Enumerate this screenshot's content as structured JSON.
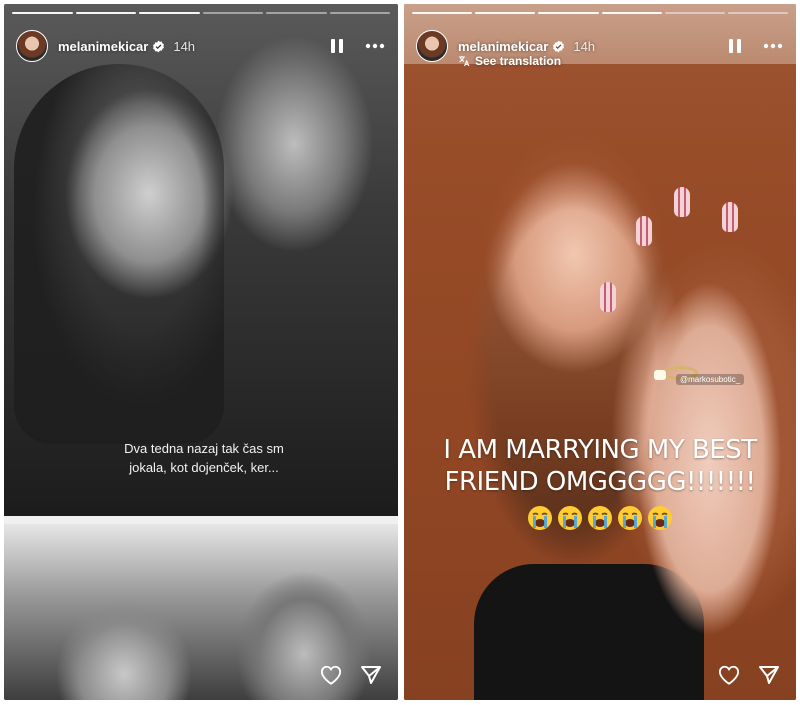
{
  "left_story": {
    "username": "melanimekicar",
    "time": "14h",
    "caption_line1": "Dva tedna nazaj tak čas sm",
    "caption_line2": "jokala, kot dojenček, ker...",
    "icons": {
      "pause": "pause-icon",
      "more": "more-icon",
      "heart": "heart-icon",
      "send": "send-icon",
      "verified": "verified-badge-icon"
    }
  },
  "right_story": {
    "username": "melanimekicar",
    "time": "14h",
    "see_translation": "See translation",
    "caption_line1": "I AM MARRYING MY BEST",
    "caption_line2": "FRIEND OMGGGGG!!!!!!!",
    "emoji_count": 5,
    "emoji_name": "loudly-crying-face",
    "mention": "@markosubotic_",
    "icons": {
      "pause": "pause-icon",
      "more": "more-icon",
      "heart": "heart-icon",
      "send": "send-icon",
      "translate": "translate-icon"
    }
  },
  "colors": {
    "white": "#ffffff",
    "emoji_yellow": "#ffcc33",
    "tear_blue": "#4aa3df"
  }
}
